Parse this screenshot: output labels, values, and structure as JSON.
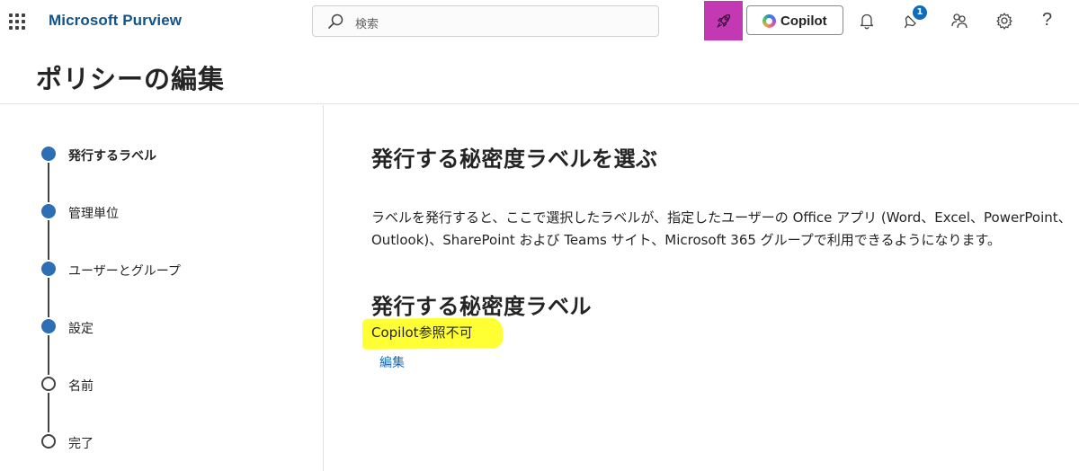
{
  "topbar": {
    "app_name": "Microsoft Purview",
    "search_placeholder": "検索",
    "copilot_label": "Copilot",
    "notification_count": "1",
    "help_glyph": "?"
  },
  "page": {
    "title": "ポリシーの編集"
  },
  "stepper": {
    "steps": [
      {
        "label": "発行するラベル",
        "state": "current"
      },
      {
        "label": "管理単位",
        "state": "done"
      },
      {
        "label": "ユーザーとグループ",
        "state": "done"
      },
      {
        "label": "設定",
        "state": "done"
      },
      {
        "label": "名前",
        "state": "pending"
      },
      {
        "label": "完了",
        "state": "pending"
      }
    ]
  },
  "main": {
    "heading": "発行する秘密度ラベルを選ぶ",
    "description": "ラベルを発行すると、ここで選択したラベルが、指定したユーザーの Office アプリ (Word、Excel、PowerPoint、Outlook)、SharePoint および Teams サイト、Microsoft 365 グループで利用できるようになります。",
    "subheading": "発行する秘密度ラベル",
    "label_name": "Copilot参照不可",
    "edit_link": "編集"
  },
  "colors": {
    "brand": "#0f548c",
    "step_filled": "#2f6db5",
    "copilot_button": "#c239b3",
    "highlight": "#ffff33",
    "link": "#0f6cbd"
  },
  "icons": [
    "waffle-icon",
    "search-icon",
    "rocket-icon",
    "copilot-logo-icon",
    "bell-icon",
    "lightbulb-icon",
    "people-icon",
    "gear-icon",
    "help-icon"
  ]
}
